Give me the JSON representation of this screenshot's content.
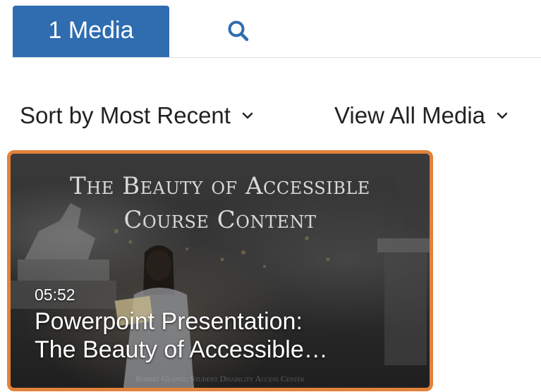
{
  "tabs": {
    "media_label": "1 Media",
    "search_icon": "search-icon"
  },
  "filters": {
    "sort_label": "Sort by Most Recent",
    "view_label": "View All Media",
    "chevron_icon": "chevron-down-icon"
  },
  "media": [
    {
      "duration": "05:52",
      "title_line1": "Powerpoint Presentation:",
      "title_line2": "The Beauty of Accessible…",
      "slide_title_line1": "The Beauty of Accessible",
      "slide_title_line2": "Course Content",
      "slide_credit": "Robert Glantz, Student Disability Access Center"
    }
  ],
  "colors": {
    "tab_active": "#2f6cb0",
    "search_icon": "#2f6cb0",
    "card_border": "#e2823a"
  }
}
